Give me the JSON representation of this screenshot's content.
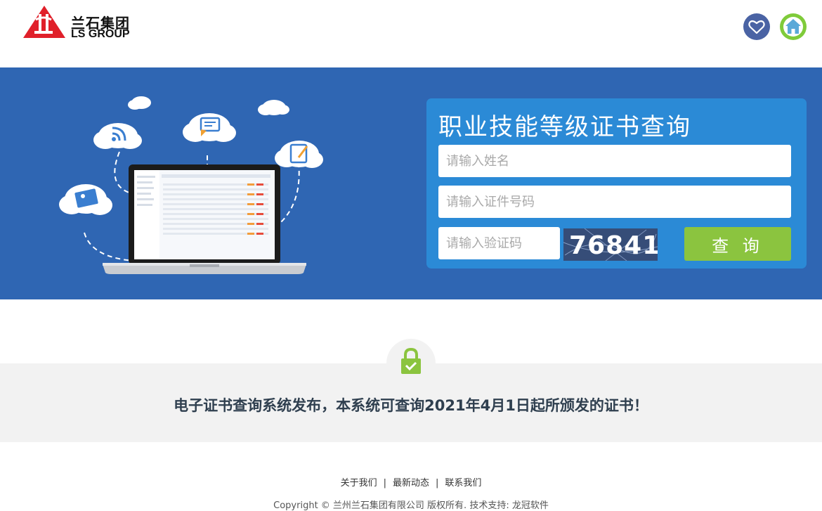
{
  "brand": {
    "name_cn": "兰石集团",
    "name_en": "LS GROUP",
    "logo_color": "#e0202a"
  },
  "header": {
    "favorite_icon": "heart-icon",
    "home_icon": "home-icon"
  },
  "query_panel": {
    "title": "职业技能等级证书查询",
    "name_placeholder": "请输入姓名",
    "id_placeholder": "请输入证件号码",
    "code_placeholder": "请输入验证码",
    "captcha_value": "76841",
    "submit_label": "查 询"
  },
  "notice": {
    "icon": "lock-check-icon",
    "text": "电子证书查询系统发布，本系统可查询2021年4月1日起所颁发的证书！"
  },
  "footer": {
    "links": [
      "关于我们",
      "最新动态",
      "联系我们"
    ],
    "separator": "|",
    "copyright": "Copyright © 兰州兰石集团有限公司 版权所有. 技术支持: 龙冠软件"
  },
  "colors": {
    "banner_bg": "#2f66b3",
    "panel_bg": "#2b8ad6",
    "submit_bg": "#8bc43f",
    "lock_icon": "#8bc43f",
    "favorite_bg": "#4a63a4",
    "home_bg": "#7fcb3a"
  }
}
